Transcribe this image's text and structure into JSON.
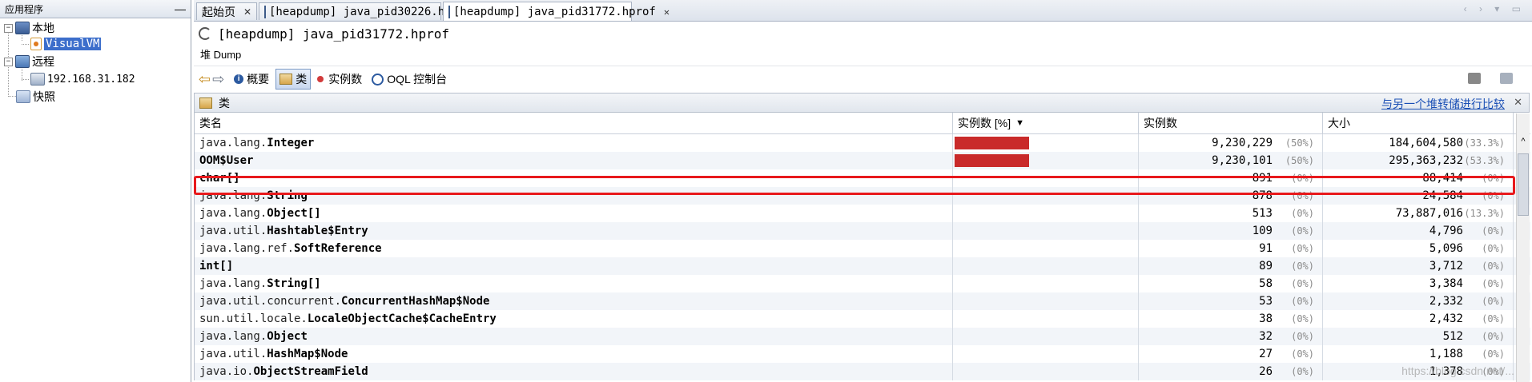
{
  "left_panel": {
    "title": "应用程序",
    "minimize": "—",
    "tree": {
      "local": "本地",
      "visualvm": "VisualVM",
      "remote": "远程",
      "remote_host": "192.168.31.182",
      "snapshots": "快照"
    }
  },
  "tabs": [
    {
      "label": "起始页",
      "close": "✕"
    },
    {
      "label": "[heapdump] java_pid30226.hprof",
      "close": "✕"
    },
    {
      "label": "[heapdump] java_pid31772.hprof",
      "close": "✕"
    }
  ],
  "tab_nav": "‹ › ▾ ▭",
  "header": {
    "title": "[heapdump] java_pid31772.hprof",
    "subtab": "堆 Dump"
  },
  "toolbar": {
    "back": "⇦",
    "forward": "⇨",
    "summary": "概要",
    "classes": "类",
    "instances": "实例数",
    "oql": "OQL 控制台"
  },
  "class_panel": {
    "title": "类",
    "compare_link": "与另一个堆转储进行比较",
    "close": "✕"
  },
  "table": {
    "columns": [
      "类名",
      "实例数 [%]",
      "实例数",
      "大小"
    ],
    "sort_indicator": "▼",
    "rows": [
      {
        "pkg": "java.lang.",
        "cls": "Integer",
        "share": 0.5,
        "count": "9,230,229",
        "count_pct": "(50%)",
        "size": "184,604,580",
        "size_pct": "(33.3%)"
      },
      {
        "pkg": "",
        "cls": "OOM$User",
        "share": 0.5,
        "count": "9,230,101",
        "count_pct": "(50%)",
        "size": "295,363,232",
        "size_pct": "(53.3%)"
      },
      {
        "pkg": "",
        "cls": "char[]",
        "share": 0,
        "count": "891",
        "count_pct": "(0%)",
        "size": "88,414",
        "size_pct": "(0%)"
      },
      {
        "pkg": "java.lang.",
        "cls": "String",
        "share": 0,
        "count": "878",
        "count_pct": "(0%)",
        "size": "24,584",
        "size_pct": "(0%)"
      },
      {
        "pkg": "java.lang.",
        "cls": "Object[]",
        "share": 0,
        "count": "513",
        "count_pct": "(0%)",
        "size": "73,887,016",
        "size_pct": "(13.3%)"
      },
      {
        "pkg": "java.util.",
        "cls": "Hashtable$Entry",
        "share": 0,
        "count": "109",
        "count_pct": "(0%)",
        "size": "4,796",
        "size_pct": "(0%)"
      },
      {
        "pkg": "java.lang.ref.",
        "cls": "SoftReference",
        "share": 0,
        "count": "91",
        "count_pct": "(0%)",
        "size": "5,096",
        "size_pct": "(0%)"
      },
      {
        "pkg": "",
        "cls": "int[]",
        "share": 0,
        "count": "89",
        "count_pct": "(0%)",
        "size": "3,712",
        "size_pct": "(0%)"
      },
      {
        "pkg": "java.lang.",
        "cls": "String[]",
        "share": 0,
        "count": "58",
        "count_pct": "(0%)",
        "size": "3,384",
        "size_pct": "(0%)"
      },
      {
        "pkg": "java.util.concurrent.",
        "cls": "ConcurrentHashMap$Node",
        "share": 0,
        "count": "53",
        "count_pct": "(0%)",
        "size": "2,332",
        "size_pct": "(0%)"
      },
      {
        "pkg": "sun.util.locale.",
        "cls": "LocaleObjectCache$CacheEntry",
        "share": 0,
        "count": "38",
        "count_pct": "(0%)",
        "size": "2,432",
        "size_pct": "(0%)"
      },
      {
        "pkg": "java.lang.",
        "cls": "Object",
        "share": 0,
        "count": "32",
        "count_pct": "(0%)",
        "size": "512",
        "size_pct": "(0%)"
      },
      {
        "pkg": "java.util.",
        "cls": "HashMap$Node",
        "share": 0,
        "count": "27",
        "count_pct": "(0%)",
        "size": "1,188",
        "size_pct": "(0%)"
      },
      {
        "pkg": "java.io.",
        "cls": "ObjectStreamField",
        "share": 0,
        "count": "26",
        "count_pct": "(0%)",
        "size": "1,378",
        "size_pct": "(0%)"
      }
    ]
  },
  "watermark": "https://blog.csdn.net/...",
  "colors": {
    "bar": "#c92a2a",
    "highlight": "#e8191c",
    "link": "#1a4fb5",
    "selection": "#3c6ecb"
  }
}
